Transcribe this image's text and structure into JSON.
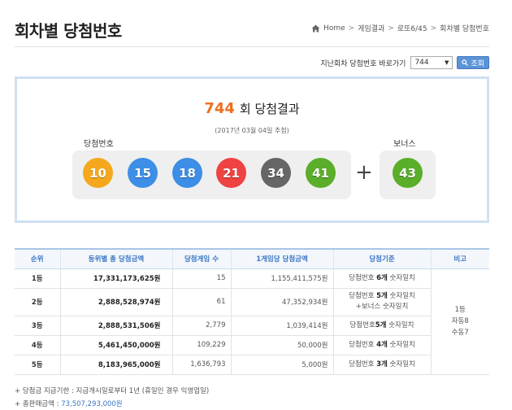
{
  "page": {
    "title": "회차별 당첨번호"
  },
  "breadcrumb": {
    "items": [
      "Home",
      "게임결과",
      "로또6/45",
      "회차별 당첨번호"
    ]
  },
  "round_nav": {
    "label": "지난회차 당첨번호 바로가기",
    "selected": "744",
    "search_label": "조회"
  },
  "result": {
    "round": "744",
    "title_suffix": "회 당첨결과",
    "date": "(2017년 03월 04일 추첨)",
    "winning_label": "당첨번호",
    "bonus_label": "보너스",
    "numbers": [
      "10",
      "15",
      "18",
      "21",
      "34",
      "41"
    ],
    "bonus": "43",
    "plus": "+",
    "colors": {
      "yellow": "#f5a81e",
      "blue": "#3d8ee6",
      "red": "#ef4242",
      "gray": "#666666",
      "green": "#5aae2a",
      "accent": "#ef6f1e"
    }
  },
  "table": {
    "headers": [
      "순위",
      "등위별 총 당첨금액",
      "당첨게임 수",
      "1게임당 당첨금액",
      "당첨기준",
      "비고"
    ],
    "rows": [
      {
        "rank": "1등",
        "total": "17,331,173,625원",
        "count": "15",
        "per": "1,155,411,575원",
        "crit_pre": "당첨번호 ",
        "crit_bold": "6개",
        "crit_post": " 숫자일치",
        "crit_line2": ""
      },
      {
        "rank": "2등",
        "total": "2,888,528,974원",
        "count": "61",
        "per": "47,352,934원",
        "crit_pre": "당첨번호 ",
        "crit_bold": "5개",
        "crit_post": " 숫자일치",
        "crit_line2": "+보너스 숫자일치"
      },
      {
        "rank": "3등",
        "total": "2,888,531,506원",
        "count": "2,779",
        "per": "1,039,414원",
        "crit_pre": "당첨번호",
        "crit_bold": "5개",
        "crit_post": " 숫자일치",
        "crit_line2": ""
      },
      {
        "rank": "4등",
        "total": "5,461,450,000원",
        "count": "109,229",
        "per": "50,000원",
        "crit_pre": "당첨번호 ",
        "crit_bold": "4개",
        "crit_post": " 숫자일치",
        "crit_line2": ""
      },
      {
        "rank": "5등",
        "total": "8,183,965,000원",
        "count": "1,636,793",
        "per": "5,000원",
        "crit_pre": "당첨번호 ",
        "crit_bold": "3개",
        "crit_post": " 숫자일치",
        "crit_line2": ""
      }
    ],
    "note": [
      "1등",
      "자동8",
      "수동7"
    ]
  },
  "footnotes": {
    "deadline": "+ 당첨금 지급기한 : 지급개시일로부터 1년 (휴일인 경우 익영업일)",
    "sales_label": "+ 총판매금액 : ",
    "sales_value": "73,507,293,000원"
  }
}
